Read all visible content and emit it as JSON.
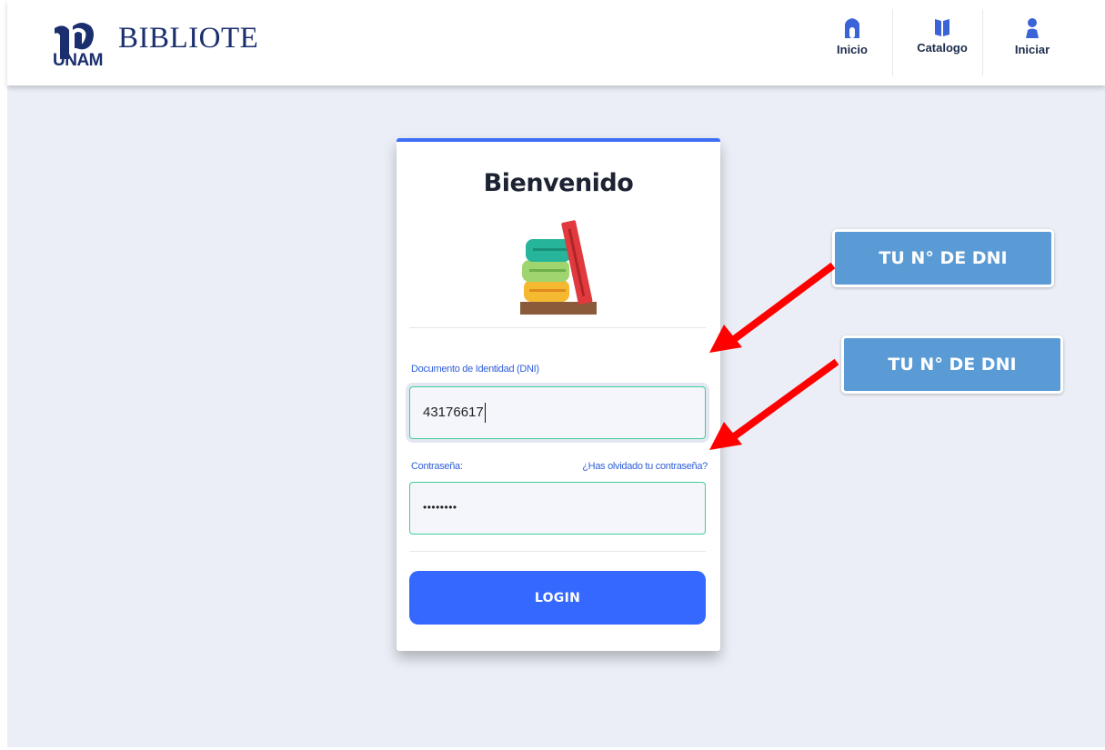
{
  "header": {
    "logo_text": "UNAM",
    "brand": "BIBLIOTECA",
    "nav": [
      {
        "label": "Inicio",
        "icon": "home-icon"
      },
      {
        "label": "Catalogo",
        "icon": "book-icon"
      },
      {
        "label": "Iniciar",
        "icon": "user-icon"
      }
    ]
  },
  "login_card": {
    "title": "Bienvenido",
    "image": "books-illustration",
    "dni_label": "Documento de Identidad (DNI)",
    "dni_value": "43176617",
    "password_label": "Contraseña:",
    "forgot_link": "¿Has olvidado tu contraseña?",
    "password_value": "••••••••",
    "login_button": "LOGIN"
  },
  "annotations": [
    {
      "text": "TU N° DE DNI"
    },
    {
      "text": "TU N° DE DNI"
    }
  ],
  "colors": {
    "accent": "#3568ff",
    "card_top_border": "#3d6ef5",
    "input_border": "#3fcf98",
    "brand_navy": "#1b2f6e",
    "callout": "#5b9bd5",
    "arrow": "#ff0000",
    "page_background": "#ebeef6"
  }
}
